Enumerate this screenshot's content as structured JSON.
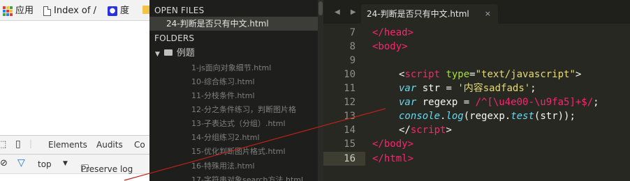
{
  "browser": {
    "bookmarks": {
      "apps_label": "应用",
      "index_label": "Index of /",
      "baidu_label": "度"
    },
    "devtools": {
      "tabs": [
        "Elements",
        "Audits",
        "Co"
      ],
      "context": "top",
      "preserve_log": "Preserve log"
    }
  },
  "sidebar": {
    "open_files_title": "OPEN FILES",
    "open_file": "24-判断是否只有中文.html",
    "folders_title": "FOLDERS",
    "folder_name": "例题",
    "files": [
      "1-js面向对象细节.html",
      "10-综合练习.html",
      "11-分枝条件.html",
      "12-分之条件练习，判断图片格",
      "13-子表达式（分组）.html",
      "14-分组练习2.html",
      "15-优化判断图片格式.html",
      "16-特殊用法.html",
      "17-字符串对象search方法.html"
    ]
  },
  "editor": {
    "tab_nav": "◀ ▶",
    "tab_title": "24-判断是否只有中文.html",
    "tab_close": "×",
    "line_numbers": [
      "7",
      "8",
      "9",
      "10",
      "11",
      "12",
      "13",
      "14",
      "15",
      "16"
    ],
    "current_line": "16",
    "code": {
      "l7": "</head>",
      "l8": "<body>",
      "l10_tag_open": "<",
      "l10_tag": "script",
      "l10_attr": "type",
      "l10_eq": "=",
      "l10_val": "\"text/javascript\"",
      "l10_close": ">",
      "l11_kw": "var",
      "l11_rest": " str = ",
      "l11_str": "'内容sadfads'",
      "l11_end": ";",
      "l12_kw": "var",
      "l12_rest": " regexp = ",
      "l12_rx": "/^[\\u4e00-\\u9fa5]+$/",
      "l12_end": ";",
      "l13_fn": "console",
      "l13_a": ".",
      "l13_log": "log",
      "l13_b": "(regexp.",
      "l13_test": "test",
      "l13_c": "(str));",
      "l14_open": "</",
      "l14_tag": "script",
      "l14_close": ">",
      "l15": "</body>",
      "l16": "</html>"
    }
  },
  "colors": {
    "editor_bg": "#272822",
    "sidebar_bg": "#1e1f1c",
    "tag": "#f92672",
    "string": "#e6db74",
    "keyword": "#66d9ef",
    "attr": "#a6e22e",
    "annotation_line": "#c0201a"
  }
}
